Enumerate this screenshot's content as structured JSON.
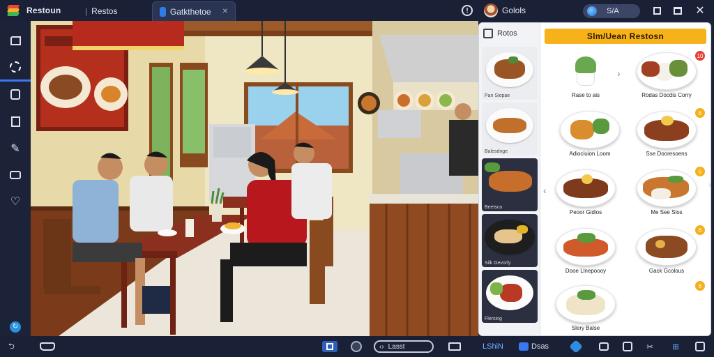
{
  "titlebar": {
    "app_title": "Restoun",
    "tabs": [
      {
        "label": "Restos",
        "active": false
      },
      {
        "label": "Gatkthetoe",
        "active": true
      }
    ],
    "user_name": "Golols",
    "sync_label": "S/A",
    "colors": {
      "bar": "#1a2036",
      "accent": "#3a78f2"
    }
  },
  "sidebar": {
    "items": [
      {
        "icon": "home-icon"
      },
      {
        "icon": "settings-icon"
      },
      {
        "icon": "app-icon"
      },
      {
        "icon": "document-icon"
      },
      {
        "icon": "brush-icon"
      },
      {
        "icon": "camera-icon"
      },
      {
        "icon": "heart-icon"
      }
    ],
    "bottom_items": [
      {
        "icon": "refresh-icon"
      },
      {
        "icon": "back-icon"
      }
    ]
  },
  "menu": {
    "left_header": "Rotos",
    "title": "Slm/Uean Restosn",
    "thumbnails": [
      {
        "caption": "Pan Siopae"
      },
      {
        "caption": "Balesdnge"
      },
      {
        "caption": "Beetsco"
      },
      {
        "caption": "Silk Gevorly"
      },
      {
        "caption": "Flersing"
      }
    ],
    "items": [
      {
        "label": "Rase to ais",
        "badge": ""
      },
      {
        "label": "Rodas Docdis Corry",
        "badge": "10"
      },
      {
        "label": "Adiociuion Loom",
        "badge": ""
      },
      {
        "label": "Sse Dooresoens",
        "badge": "6"
      },
      {
        "label": "Peoor Gidios",
        "badge": ""
      },
      {
        "label": "Me See Slos",
        "badge": "6"
      },
      {
        "label": "Dooe Llnepoooy",
        "badge": ""
      },
      {
        "label": "Gack Gcolous",
        "badge": "6"
      },
      {
        "label": "Slery Balse",
        "badge": "6"
      }
    ]
  },
  "taskbar": {
    "search_label": "Lasst",
    "screen_label": "LShiN",
    "games_label": "Dsas"
  }
}
